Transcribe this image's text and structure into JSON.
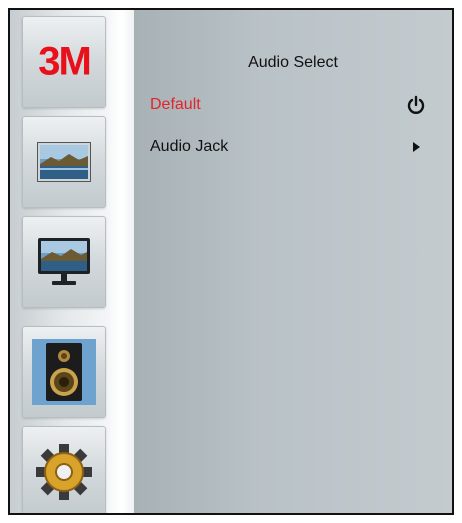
{
  "brand": {
    "logo_text": "3M",
    "color": "#e8101a"
  },
  "sidebar": {
    "items": [
      {
        "id": "logo",
        "icon": "3m-logo"
      },
      {
        "id": "picture",
        "icon": "landscape-picture-icon"
      },
      {
        "id": "display",
        "icon": "monitor-icon"
      },
      {
        "id": "audio",
        "icon": "speaker-icon",
        "active": true
      },
      {
        "id": "settings",
        "icon": "gear-icon"
      }
    ]
  },
  "menu": {
    "title": "Audio Select",
    "items": [
      {
        "label": "Default",
        "indicator": "power-icon",
        "selected": true,
        "color": "#e3242b"
      },
      {
        "label": "Audio Jack",
        "indicator": "arrow-right-icon",
        "selected": false
      }
    ]
  }
}
